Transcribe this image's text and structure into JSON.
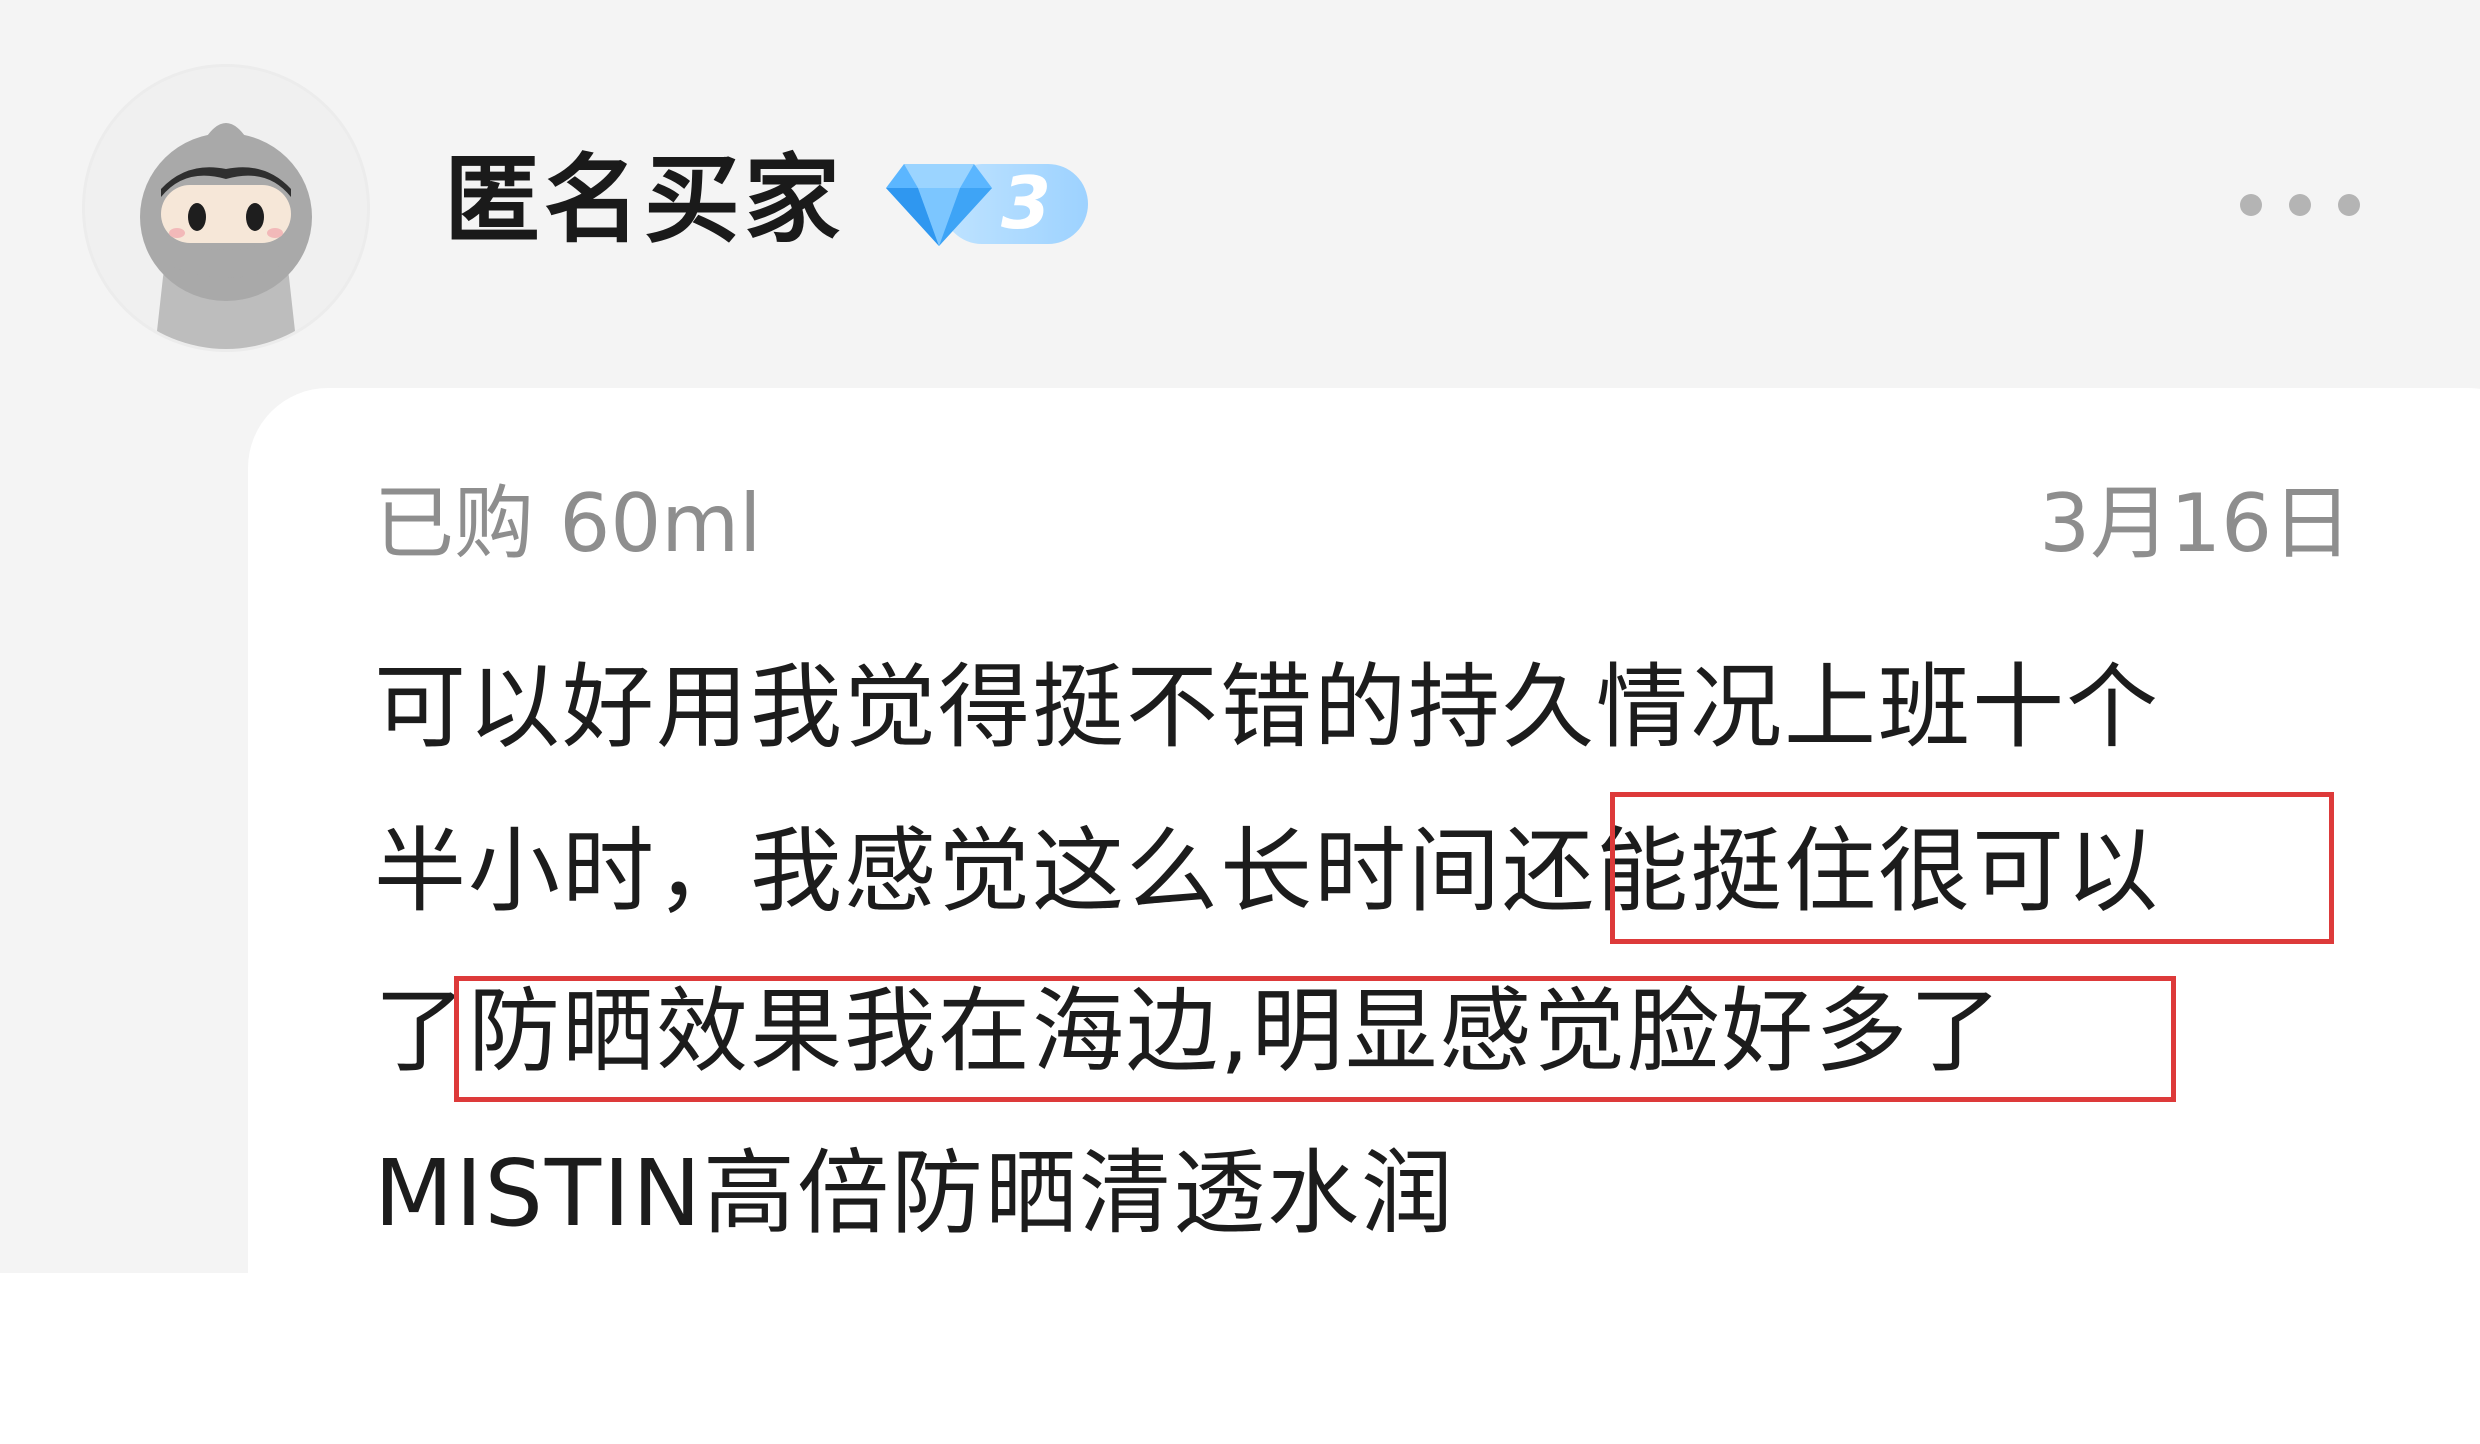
{
  "reviewer": {
    "name": "匿名买家",
    "avatar_icon": "ninja-avatar-icon",
    "level_icon": "diamond-icon",
    "level": "3",
    "level_color": "#3aa0f5"
  },
  "menu": {
    "more_icon": "more-dots-icon"
  },
  "review": {
    "purchase_info": "已购 60ml",
    "date": "3月16日",
    "lines": [
      "可以好用我觉得挺不错的持久情况上班十个",
      "半小时，我感觉这么长时间还能挺住很可以",
      "了防晒效果我在海边,明显感觉脸好多了",
      "MISTIN高倍防晒清透水润"
    ],
    "highlight_color": "#dd3a3a",
    "highlighted_phrases": [
      "还能挺住很可以",
      "防晒效果我在海边,明显感觉脸好多了"
    ]
  }
}
